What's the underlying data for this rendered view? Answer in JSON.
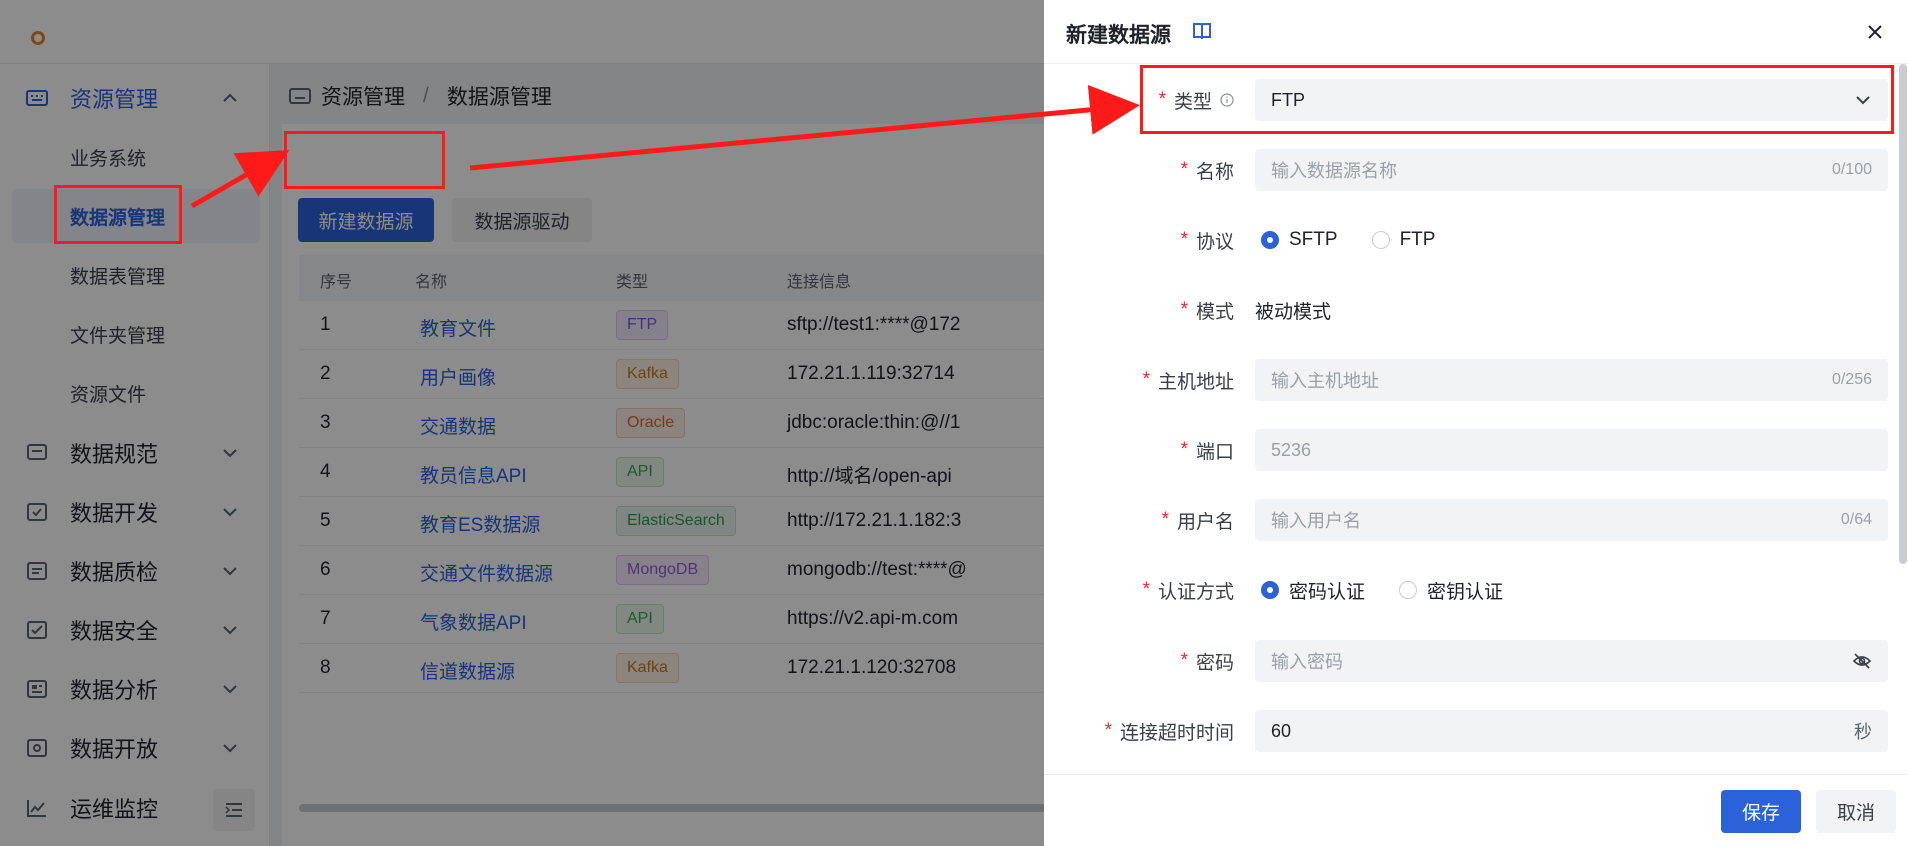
{
  "sidebar": {
    "groups": [
      {
        "label": "资源管理",
        "icon": "keyboard-icon"
      },
      {
        "label": "数据规范",
        "icon": "monitor-icon"
      },
      {
        "label": "数据开发",
        "icon": "dev-icon"
      },
      {
        "label": "数据质检",
        "icon": "quality-icon"
      },
      {
        "label": "数据安全",
        "icon": "security-icon"
      },
      {
        "label": "数据分析",
        "icon": "analysis-icon"
      },
      {
        "label": "数据开放",
        "icon": "open-icon"
      },
      {
        "label": "运维监控",
        "icon": "monitor-chart-icon"
      }
    ],
    "sub_items": [
      "业务系统",
      "数据源管理",
      "数据表管理",
      "文件夹管理",
      "资源文件"
    ]
  },
  "breadcrumb": {
    "root": "资源管理",
    "sep": "/",
    "current": "数据源管理"
  },
  "toolbar": {
    "new_label": "新建数据源",
    "driver_label": "数据源驱动"
  },
  "table": {
    "columns": [
      "序号",
      "名称",
      "类型",
      "连接信息"
    ],
    "rows": [
      {
        "no": "1",
        "name": "教育文件",
        "type": "FTP",
        "conn": "sftp://test1:****@172"
      },
      {
        "no": "2",
        "name": "用户画像",
        "type": "Kafka",
        "conn": "172.21.1.119:32714"
      },
      {
        "no": "3",
        "name": "交通数据",
        "type": "Oracle",
        "conn": "jdbc:oracle:thin:@//1"
      },
      {
        "no": "4",
        "name": "教员信息API",
        "type": "API",
        "conn": "http://域名/open-api"
      },
      {
        "no": "5",
        "name": "教育ES数据源",
        "type": "ElasticSearch",
        "conn": "http://172.21.1.182:3"
      },
      {
        "no": "6",
        "name": "交通文件数据源",
        "type": "MongoDB",
        "conn": "mongodb://test:****@"
      },
      {
        "no": "7",
        "name": "气象数据API",
        "type": "API",
        "conn": "https://v2.api-m.com"
      },
      {
        "no": "8",
        "name": "信道数据源",
        "type": "Kafka",
        "conn": "172.21.1.120:32708"
      }
    ]
  },
  "drawer": {
    "title": "新建数据源",
    "fields": {
      "type": {
        "label": "类型",
        "value": "FTP"
      },
      "name": {
        "label": "名称",
        "placeholder": "输入数据源名称",
        "count": "0/100"
      },
      "protocol": {
        "label": "协议",
        "options": [
          "SFTP",
          "FTP"
        ],
        "selected": "SFTP"
      },
      "mode": {
        "label": "模式",
        "value": "被动模式"
      },
      "host": {
        "label": "主机地址",
        "placeholder": "输入主机地址",
        "count": "0/256"
      },
      "port": {
        "label": "端口",
        "placeholder": "5236"
      },
      "username": {
        "label": "用户名",
        "placeholder": "输入用户名",
        "count": "0/64"
      },
      "auth": {
        "label": "认证方式",
        "options": [
          "密码认证",
          "密钥认证"
        ],
        "selected": "密码认证"
      },
      "password": {
        "label": "密码",
        "placeholder": "输入密码"
      },
      "timeout": {
        "label": "连接超时时间",
        "value": "60",
        "unit": "秒"
      }
    },
    "save_label": "保存",
    "cancel_label": "取消"
  },
  "colors": {
    "primary": "#2b62d9",
    "required": "#f5222d",
    "annotation": "#ff1a1a"
  }
}
